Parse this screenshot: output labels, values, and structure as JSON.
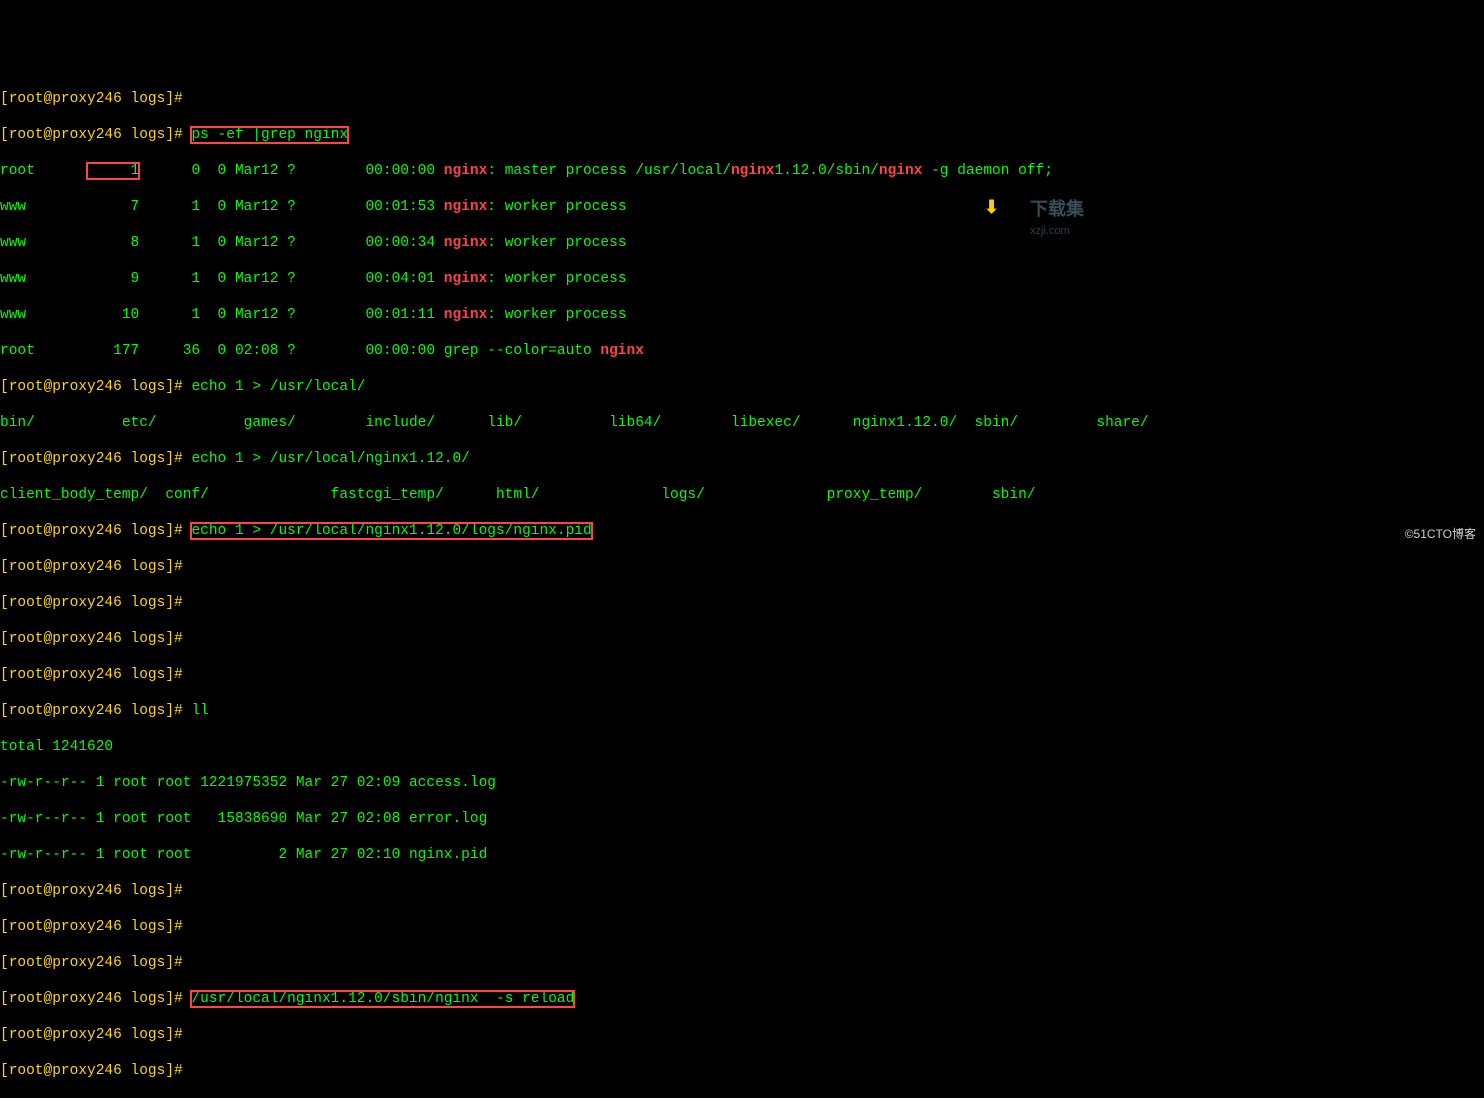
{
  "prompt": "[root@proxy246 logs]# ",
  "cmds": {
    "ps": "ps -ef |grep nginx",
    "echo_local": "echo 1 > /usr/local/",
    "echo_nginx_dir": "echo 1 > /usr/local/nginx1.12.0/",
    "echo_pid": "echo 1 > /usr/local/nginx1.12.0/logs/nginx.pid",
    "ll": "ll",
    "reload": "/usr/local/nginx1.12.0/sbin/nginx  -s reload"
  },
  "ps_header_top": "[root@proxy246 logs]# ",
  "ps_rows": [
    {
      "user": "root",
      "pid": "1",
      "ppid": "0",
      "c": "0",
      "stime": "Mar12",
      "tty": "?",
      "time": "00:00:00",
      "proc_pre": "",
      "hl": "nginx",
      "proc_mid": ": master process /usr/local/",
      "hl2": "nginx",
      "proc_mid2": "1.12.0/sbin/",
      "hl3": "nginx",
      "proc_post": " -g daemon off;"
    },
    {
      "user": "www",
      "pid": "7",
      "ppid": "1",
      "c": "0",
      "stime": "Mar12",
      "tty": "?",
      "time": "00:01:53",
      "proc_pre": "",
      "hl": "nginx",
      "proc_mid": ": worker process",
      "hl2": "",
      "proc_mid2": "",
      "hl3": "",
      "proc_post": ""
    },
    {
      "user": "www",
      "pid": "8",
      "ppid": "1",
      "c": "0",
      "stime": "Mar12",
      "tty": "?",
      "time": "00:00:34",
      "proc_pre": "",
      "hl": "nginx",
      "proc_mid": ": worker process",
      "hl2": "",
      "proc_mid2": "",
      "hl3": "",
      "proc_post": ""
    },
    {
      "user": "www",
      "pid": "9",
      "ppid": "1",
      "c": "0",
      "stime": "Mar12",
      "tty": "?",
      "time": "00:04:01",
      "proc_pre": "",
      "hl": "nginx",
      "proc_mid": ": worker process",
      "hl2": "",
      "proc_mid2": "",
      "hl3": "",
      "proc_post": ""
    },
    {
      "user": "www",
      "pid": "10",
      "ppid": "1",
      "c": "0",
      "stime": "Mar12",
      "tty": "?",
      "time": "00:01:11",
      "proc_pre": "",
      "hl": "nginx",
      "proc_mid": ": worker process",
      "hl2": "",
      "proc_mid2": "",
      "hl3": "",
      "proc_post": ""
    },
    {
      "user": "root",
      "pid": "177",
      "ppid": "36",
      "c": "0",
      "stime": "02:08",
      "tty": "?",
      "time": "00:00:00",
      "proc_pre": "grep --color=auto ",
      "hl": "nginx",
      "proc_mid": "",
      "hl2": "",
      "proc_mid2": "",
      "hl3": "",
      "proc_post": ""
    }
  ],
  "tab1": "bin/          etc/          games/        include/      lib/          lib64/        libexec/      nginx1.12.0/  sbin/         share/",
  "tab2": "client_body_temp/  conf/              fastcgi_temp/      html/              logs/              proxy_temp/        sbin/",
  "ll_total": "total 1241620",
  "ll_rows": [
    "-rw-r--r-- 1 root root 1221975352 Mar 27 02:09 access.log",
    "-rw-r--r-- 1 root root   15838690 Mar 27 02:08 error.log",
    "-rw-r--r-- 1 root root          2 Mar 27 02:10 nginx.pid"
  ],
  "watermark_main": "下载集",
  "watermark_sub": "xzji.com",
  "footer": "©51CTO博客"
}
